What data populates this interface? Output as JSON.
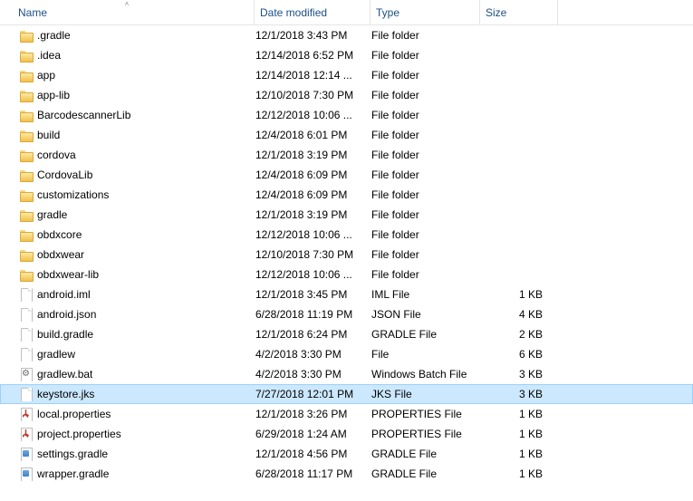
{
  "columns": {
    "name": "Name",
    "date": "Date modified",
    "type": "Type",
    "size": "Size"
  },
  "sort": {
    "column": "name",
    "direction": "asc"
  },
  "selected_index": 18,
  "items": [
    {
      "name": ".gradle",
      "date": "12/1/2018 3:43 PM",
      "type": "File folder",
      "size": "",
      "icon": "folder"
    },
    {
      "name": ".idea",
      "date": "12/14/2018 6:52 PM",
      "type": "File folder",
      "size": "",
      "icon": "folder"
    },
    {
      "name": "app",
      "date": "12/14/2018 12:14 ...",
      "type": "File folder",
      "size": "",
      "icon": "folder"
    },
    {
      "name": "app-lib",
      "date": "12/10/2018 7:30 PM",
      "type": "File folder",
      "size": "",
      "icon": "folder"
    },
    {
      "name": "BarcodescannerLib",
      "date": "12/12/2018 10:06 ...",
      "type": "File folder",
      "size": "",
      "icon": "folder"
    },
    {
      "name": "build",
      "date": "12/4/2018 6:01 PM",
      "type": "File folder",
      "size": "",
      "icon": "folder"
    },
    {
      "name": "cordova",
      "date": "12/1/2018 3:19 PM",
      "type": "File folder",
      "size": "",
      "icon": "folder"
    },
    {
      "name": "CordovaLib",
      "date": "12/4/2018 6:09 PM",
      "type": "File folder",
      "size": "",
      "icon": "folder"
    },
    {
      "name": "customizations",
      "date": "12/4/2018 6:09 PM",
      "type": "File folder",
      "size": "",
      "icon": "folder"
    },
    {
      "name": "gradle",
      "date": "12/1/2018 3:19 PM",
      "type": "File folder",
      "size": "",
      "icon": "folder"
    },
    {
      "name": "obdxcore",
      "date": "12/12/2018 10:06 ...",
      "type": "File folder",
      "size": "",
      "icon": "folder"
    },
    {
      "name": "obdxwear",
      "date": "12/10/2018 7:30 PM",
      "type": "File folder",
      "size": "",
      "icon": "folder"
    },
    {
      "name": "obdxwear-lib",
      "date": "12/12/2018 10:06 ...",
      "type": "File folder",
      "size": "",
      "icon": "folder"
    },
    {
      "name": "android.iml",
      "date": "12/1/2018 3:45 PM",
      "type": "IML File",
      "size": "1 KB",
      "icon": "file"
    },
    {
      "name": "android.json",
      "date": "6/28/2018 11:19 PM",
      "type": "JSON File",
      "size": "4 KB",
      "icon": "file"
    },
    {
      "name": "build.gradle",
      "date": "12/1/2018 6:24 PM",
      "type": "GRADLE File",
      "size": "2 KB",
      "icon": "file"
    },
    {
      "name": "gradlew",
      "date": "4/2/2018 3:30 PM",
      "type": "File",
      "size": "6 KB",
      "icon": "file"
    },
    {
      "name": "gradlew.bat",
      "date": "4/2/2018 3:30 PM",
      "type": "Windows Batch File",
      "size": "3 KB",
      "icon": "gear"
    },
    {
      "name": "keystore.jks",
      "date": "7/27/2018 12:01 PM",
      "type": "JKS File",
      "size": "3 KB",
      "icon": "file"
    },
    {
      "name": "local.properties",
      "date": "12/1/2018 3:26 PM",
      "type": "PROPERTIES File",
      "size": "1 KB",
      "icon": "prop"
    },
    {
      "name": "project.properties",
      "date": "6/29/2018 1:24 AM",
      "type": "PROPERTIES File",
      "size": "1 KB",
      "icon": "prop"
    },
    {
      "name": "settings.gradle",
      "date": "12/1/2018 4:56 PM",
      "type": "GRADLE File",
      "size": "1 KB",
      "icon": "conf"
    },
    {
      "name": "wrapper.gradle",
      "date": "6/28/2018 11:17 PM",
      "type": "GRADLE File",
      "size": "1 KB",
      "icon": "conf"
    }
  ]
}
